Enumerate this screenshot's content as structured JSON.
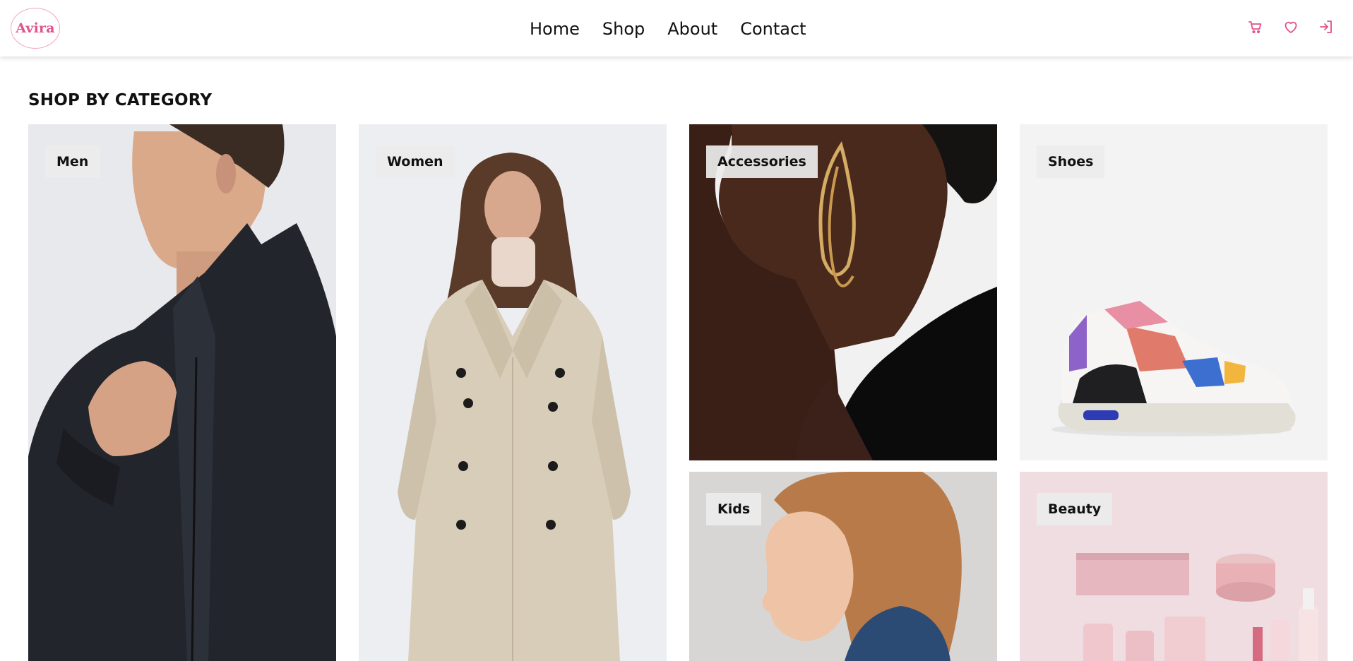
{
  "brand": {
    "name": "Avira",
    "color": "#e0528a"
  },
  "nav": {
    "items": [
      "Home",
      "Shop",
      "About",
      "Contact"
    ]
  },
  "header_icons": [
    "cart-icon",
    "heart-icon",
    "login-icon"
  ],
  "section": {
    "title": "SHOP BY CATEGORY",
    "categories": [
      {
        "label": "Men",
        "image": "man in black puffer jacket"
      },
      {
        "label": "Women",
        "image": "woman in beige trench coat"
      },
      {
        "label": "Accessories",
        "image": "woman wearing gold earring"
      },
      {
        "label": "Shoes",
        "image": "multicolor high-top sneaker"
      },
      {
        "label": "Kids",
        "image": "curly-haired child in profile"
      },
      {
        "label": "Beauty",
        "image": "pink cosmetic products flat lay"
      }
    ]
  }
}
